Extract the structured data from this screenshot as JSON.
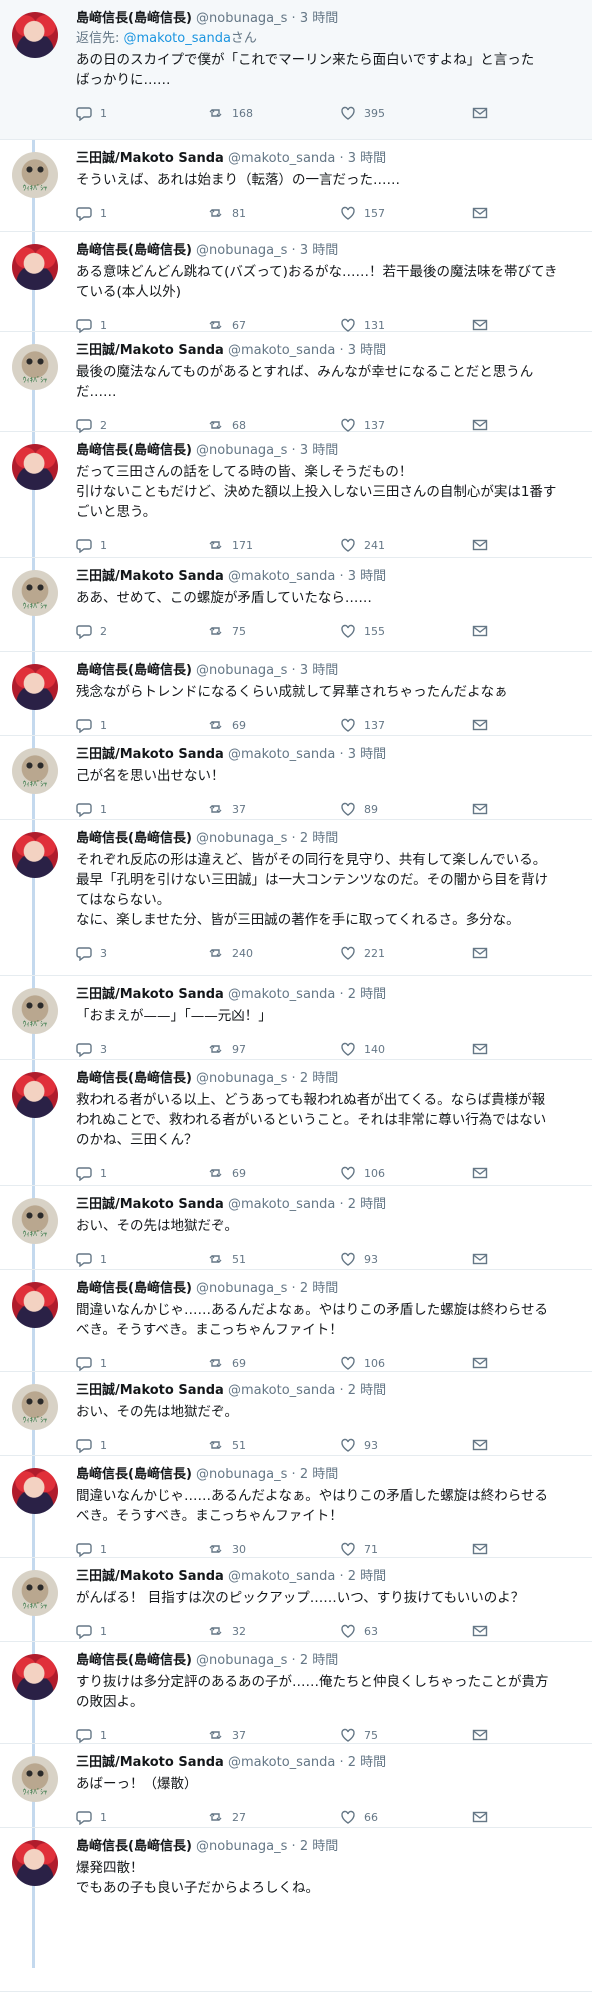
{
  "tweets": [
    {
      "user": "nobu",
      "name": "島﨑信長(島﨑信長)",
      "handle": "@nobunaga_s",
      "time": "3 時間",
      "reply_to_prefix": "返信先: ",
      "reply_to_user": "@makoto_sanda",
      "reply_to_suffix": "さん",
      "text": "あの日のスカイプで僕が「これでマーリン来たら面白いですよね」と言った\nばっかりに……",
      "replies": "1",
      "retweets": "168",
      "likes": "395"
    },
    {
      "user": "sanda",
      "name": "三田誠/Makoto Sanda",
      "handle": "@makoto_sanda",
      "time": "3 時間",
      "text": "そういえば、あれは始まり（転落）の一言だった……",
      "replies": "1",
      "retweets": "81",
      "likes": "157"
    },
    {
      "user": "nobu",
      "name": "島﨑信長(島﨑信長)",
      "handle": "@nobunaga_s",
      "time": "3 時間",
      "text": "ある意味どんどん跳ねて(バズって)おるがな……！若干最後の魔法味を帯びてき\nている(本人以外)",
      "replies": "1",
      "retweets": "67",
      "likes": "131"
    },
    {
      "user": "sanda",
      "name": "三田誠/Makoto Sanda",
      "handle": "@makoto_sanda",
      "time": "3 時間",
      "text": "最後の魔法なんてものがあるとすれば、みんなが幸せになることだと思うん\nだ……",
      "replies": "2",
      "retweets": "68",
      "likes": "137"
    },
    {
      "user": "nobu",
      "name": "島﨑信長(島﨑信長)",
      "handle": "@nobunaga_s",
      "time": "3 時間",
      "text": "だって三田さんの話をしてる時の皆、楽しそうだもの！\n引けないこともだけど、決めた額以上投入しない三田さんの自制心が実は1番す\nごいと思う。",
      "replies": "1",
      "retweets": "171",
      "likes": "241"
    },
    {
      "user": "sanda",
      "name": "三田誠/Makoto Sanda",
      "handle": "@makoto_sanda",
      "time": "3 時間",
      "text": "ああ、せめて、この螺旋が矛盾していたなら……",
      "replies": "2",
      "retweets": "75",
      "likes": "155"
    },
    {
      "user": "nobu",
      "name": "島﨑信長(島﨑信長)",
      "handle": "@nobunaga_s",
      "time": "3 時間",
      "text": "残念ながらトレンドになるくらい成就して昇華されちゃったんだよなぁ",
      "replies": "1",
      "retweets": "69",
      "likes": "137"
    },
    {
      "user": "sanda",
      "name": "三田誠/Makoto Sanda",
      "handle": "@makoto_sanda",
      "time": "3 時間",
      "text": "己が名を思い出せない！",
      "replies": "1",
      "retweets": "37",
      "likes": "89"
    },
    {
      "user": "nobu",
      "name": "島﨑信長(島﨑信長)",
      "handle": "@nobunaga_s",
      "time": "2 時間",
      "text": "それぞれ反応の形は違えど、皆がその同行を見守り、共有して楽しんでいる。\n最早「孔明を引けない三田誠」は一大コンテンツなのだ。その闇から目を背け\nてはならない。\nなに、楽しませた分、皆が三田誠の著作を手に取ってくれるさ。多分な。",
      "replies": "3",
      "retweets": "240",
      "likes": "221"
    },
    {
      "user": "sanda",
      "name": "三田誠/Makoto Sanda",
      "handle": "@makoto_sanda",
      "time": "2 時間",
      "text": "「おまえが——」「——元凶！」",
      "replies": "3",
      "retweets": "97",
      "likes": "140"
    },
    {
      "user": "nobu",
      "name": "島﨑信長(島﨑信長)",
      "handle": "@nobunaga_s",
      "time": "2 時間",
      "text": "救われる者がいる以上、どうあっても報われぬ者が出てくる。ならば貴様が報\nわれぬことで、救われる者がいるということ。それは非常に尊い行為ではない\nのかね、三田くん？",
      "replies": "1",
      "retweets": "69",
      "likes": "106"
    },
    {
      "user": "sanda",
      "name": "三田誠/Makoto Sanda",
      "handle": "@makoto_sanda",
      "time": "2 時間",
      "text": "おい、その先は地獄だぞ。",
      "replies": "1",
      "retweets": "51",
      "likes": "93"
    },
    {
      "user": "nobu",
      "name": "島﨑信長(島﨑信長)",
      "handle": "@nobunaga_s",
      "time": "2 時間",
      "text": "間違いなんかじゃ……あるんだよなぁ。やはりこの矛盾した螺旋は終わらせる\nべき。そうすべき。まこっちゃんファイト！",
      "replies": "1",
      "retweets": "69",
      "likes": "106"
    },
    {
      "user": "sanda",
      "name": "三田誠/Makoto Sanda",
      "handle": "@makoto_sanda",
      "time": "2 時間",
      "text": "おい、その先は地獄だぞ。",
      "replies": "1",
      "retweets": "51",
      "likes": "93"
    },
    {
      "user": "nobu",
      "name": "島﨑信長(島﨑信長)",
      "handle": "@nobunaga_s",
      "time": "2 時間",
      "text": "間違いなんかじゃ……あるんだよなぁ。やはりこの矛盾した螺旋は終わらせる\nべき。そうすべき。まこっちゃんファイト！",
      "replies": "1",
      "retweets": "30",
      "likes": "71"
    },
    {
      "user": "sanda",
      "name": "三田誠/Makoto Sanda",
      "handle": "@makoto_sanda",
      "time": "2 時間",
      "text": "がんばる！ 目指すは次のピックアップ……いつ、すり抜けてもいいのよ？",
      "replies": "1",
      "retweets": "32",
      "likes": "63"
    },
    {
      "user": "nobu",
      "name": "島﨑信長(島﨑信長)",
      "handle": "@nobunaga_s",
      "time": "2 時間",
      "text": "すり抜けは多分定評のあるあの子が……俺たちと仲良くしちゃったことが貴方\nの敗因よ。",
      "replies": "1",
      "retweets": "37",
      "likes": "75"
    },
    {
      "user": "sanda",
      "name": "三田誠/Makoto Sanda",
      "handle": "@makoto_sanda",
      "time": "2 時間",
      "text": "あばーっ！（爆散）",
      "replies": "1",
      "retweets": "27",
      "likes": "66"
    },
    {
      "user": "nobu",
      "name": "島﨑信長(島﨑信長)",
      "handle": "@nobunaga_s",
      "time": "2 時間",
      "text": "爆発四散！\nでもあの子も良い子だからよろしくね。",
      "replies": "",
      "retweets": "",
      "likes": ""
    }
  ]
}
